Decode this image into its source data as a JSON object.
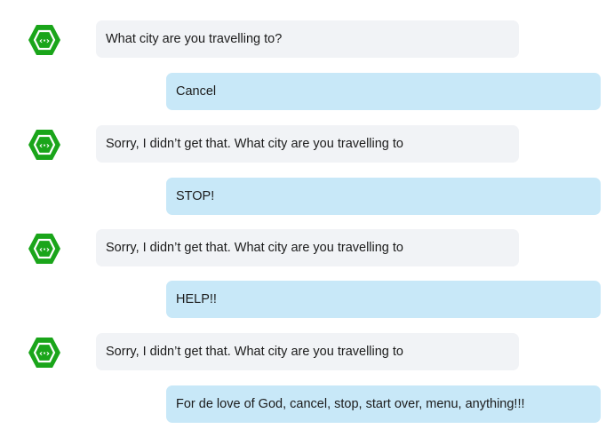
{
  "conversation": {
    "bot_avatar_icon": "chat-bot-hexagon-icon",
    "bot_color": "#1aa51a",
    "bot_bubble_color": "#f1f3f6",
    "user_bubble_color": "#c8e8f8",
    "messages": [
      {
        "sender": "bot",
        "text": "What city are you travelling to?"
      },
      {
        "sender": "user",
        "text": "Cancel"
      },
      {
        "sender": "bot",
        "text": "Sorry, I didn’t get that. What city are you travelling to"
      },
      {
        "sender": "user",
        "text": "STOP!"
      },
      {
        "sender": "bot",
        "text": "Sorry, I didn’t get that. What city are you travelling to"
      },
      {
        "sender": "user",
        "text": "HELP!!"
      },
      {
        "sender": "bot",
        "text": "Sorry, I didn’t get that. What city are you travelling to"
      },
      {
        "sender": "user",
        "text": "For de love of God, cancel, stop, start over, menu, anything!!!"
      }
    ]
  }
}
